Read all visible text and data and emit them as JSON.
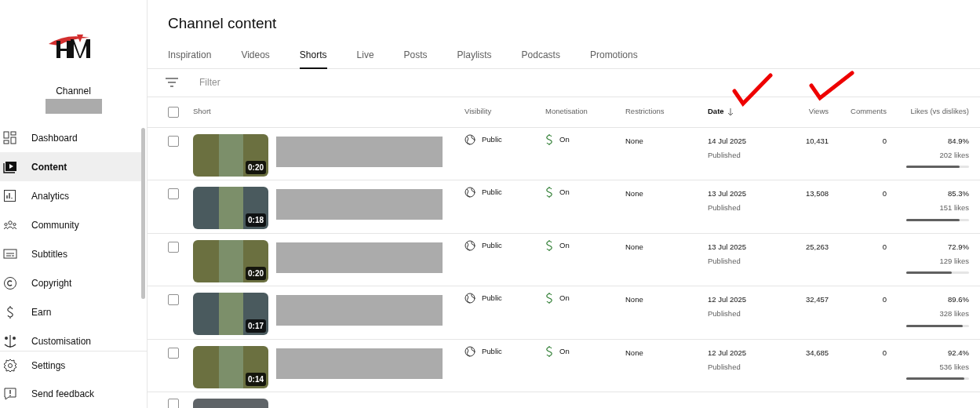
{
  "sidebar": {
    "channel_label": "Channel",
    "items": [
      {
        "label": "Dashboard",
        "selected": false
      },
      {
        "label": "Content",
        "selected": true
      },
      {
        "label": "Analytics",
        "selected": false
      },
      {
        "label": "Community",
        "selected": false
      },
      {
        "label": "Subtitles",
        "selected": false
      },
      {
        "label": "Copyright",
        "selected": false
      },
      {
        "label": "Earn",
        "selected": false
      },
      {
        "label": "Customisation",
        "selected": false
      }
    ],
    "footer_items": [
      {
        "label": "Settings"
      },
      {
        "label": "Send feedback"
      }
    ]
  },
  "title": "Channel content",
  "tabs": [
    {
      "label": "Inspiration",
      "selected": false
    },
    {
      "label": "Videos",
      "selected": false
    },
    {
      "label": "Shorts",
      "selected": true
    },
    {
      "label": "Live",
      "selected": false
    },
    {
      "label": "Posts",
      "selected": false
    },
    {
      "label": "Playlists",
      "selected": false
    },
    {
      "label": "Podcasts",
      "selected": false
    },
    {
      "label": "Promotions",
      "selected": false
    }
  ],
  "filter": {
    "placeholder": "Filter"
  },
  "table": {
    "select_all_checked": false,
    "columns": [
      {
        "label": "Short",
        "sorted": false
      },
      {
        "label": "Visibility",
        "sorted": false
      },
      {
        "label": "Monetisation",
        "sorted": false
      },
      {
        "label": "Restrictions",
        "sorted": false
      },
      {
        "label": "Date",
        "sorted": true
      },
      {
        "label": "Views",
        "sorted": false
      },
      {
        "label": "Comments",
        "sorted": false
      },
      {
        "label": "Likes (vs dislikes)",
        "sorted": false
      }
    ],
    "partial_row": {
      "checked": false
    },
    "rows": [
      {
        "checked": false,
        "duration": "0:20",
        "visibility": "Public",
        "monetisation": "On",
        "restrictions": "None",
        "date": "14 Jul 2025",
        "status": "Published",
        "views": "10,431",
        "comments": "0",
        "likes_pct": "84.9%",
        "likes": "202 likes",
        "level": 0.849
      },
      {
        "checked": false,
        "duration": "0:18",
        "visibility": "Public",
        "monetisation": "On",
        "restrictions": "None",
        "date": "13 Jul 2025",
        "status": "Published",
        "views": "13,508",
        "comments": "0",
        "likes_pct": "85.3%",
        "likes": "151 likes",
        "level": 0.853
      },
      {
        "checked": false,
        "duration": "0:20",
        "visibility": "Public",
        "monetisation": "On",
        "restrictions": "None",
        "date": "13 Jul 2025",
        "status": "Published",
        "views": "25,263",
        "comments": "0",
        "likes_pct": "72.9%",
        "likes": "129 likes",
        "level": 0.729
      },
      {
        "checked": false,
        "duration": "0:17",
        "visibility": "Public",
        "monetisation": "On",
        "restrictions": "None",
        "date": "12 Jul 2025",
        "status": "Published",
        "views": "32,457",
        "comments": "0",
        "likes_pct": "89.6%",
        "likes": "328 likes",
        "level": 0.896
      },
      {
        "checked": false,
        "duration": "0:14",
        "visibility": "Public",
        "monetisation": "On",
        "restrictions": "None",
        "date": "12 Jul 2025",
        "status": "Published",
        "views": "34,685",
        "comments": "0",
        "likes_pct": "92.4%",
        "likes": "536 likes",
        "level": 0.924
      }
    ]
  }
}
